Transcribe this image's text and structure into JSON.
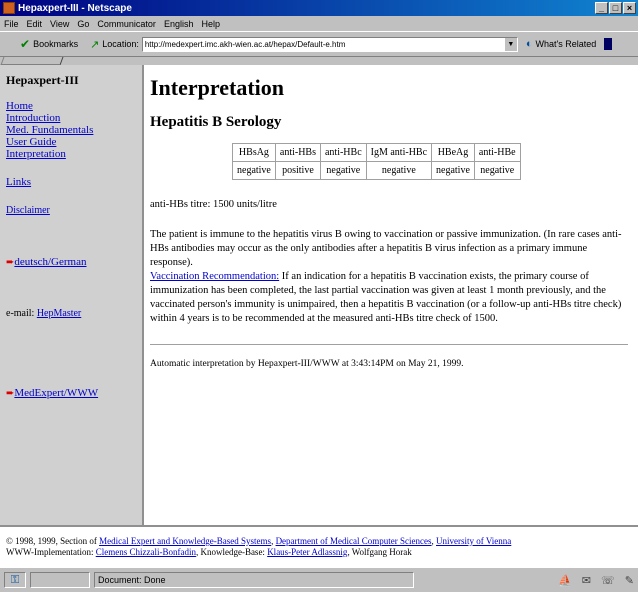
{
  "window": {
    "title": "Hepaxpert-III - Netscape"
  },
  "menu": [
    "File",
    "Edit",
    "View",
    "Go",
    "Communicator",
    "English",
    "Help"
  ],
  "toolbar": {
    "bookmarks_label": "Bookmarks",
    "location_label": "Location:",
    "url": "http://medexpert.imc.akh-wien.ac.at/hepax/Default-e.htm",
    "related_label": "What's Related"
  },
  "sidebar": {
    "brand": "Hepaxpert-III",
    "nav": {
      "home": "Home",
      "introduction": "Introduction",
      "med_fundamentals": "Med. Fundamentals",
      "user_guide": "User Guide",
      "interpretation": "Interpretation"
    },
    "links": "Links",
    "disclaimer": "Disclaimer",
    "language": "deutsch/German",
    "email_prefix": "e-mail:",
    "email_link": "HepMaster",
    "medexpert": "MedExpert/WWW"
  },
  "content": {
    "title": "Interpretation",
    "subtitle": "Hepatitis B Serology",
    "serology": {
      "headers": [
        "HBsAg",
        "anti-HBs",
        "anti-HBc",
        "IgM anti-HBc",
        "HBeAg",
        "anti-HBe"
      ],
      "values": [
        "negative",
        "positive",
        "negative",
        "negative",
        "negative",
        "negative"
      ]
    },
    "titre": "anti-HBs titre: 1500 units/litre",
    "interpretation": "The patient is immune to the hepatitis virus B owing to vaccination or passive immunization. (In rare cases anti-HBs antibodies may occur as the only antibodies after a hepatitis B virus infection as a primary immune response).",
    "recommendation_label": "Vaccination Recommendation:",
    "recommendation": " If an indication for a hepatitis B vaccination exists, the primary course of immunization has been completed, the last partial vaccination was given at least 1 month previously, and the vaccinated person's immunity is unimpaired, then a hepatitis B vaccination (or a follow-up anti-HBs titre check) within 4 years is to be recommended at the measured anti-HBs titre check of 1500.",
    "automatic": "Automatic interpretation by Hepaxpert-III/WWW at 3:43:14PM on May 21, 1999."
  },
  "footer": {
    "copyright_prefix": "© 1998, 1999, Section of",
    "link_section": "Medical Expert and Knowledge-Based Systems",
    "sep1": ",",
    "link_department": "Department of Medical Computer Sciences",
    "sep2": ",",
    "link_university": "University of Vienna",
    "implementation_prefix": "WWW-Implementation:",
    "link_implementation": "Clemens Chizzali-Bonfadin",
    "kb_prefix": ", Knowledge-Base:",
    "link_kb": "Klaus-Peter Adlassnig",
    "author": ", Wolfgang Horak"
  },
  "status": {
    "message": "Document: Done"
  }
}
